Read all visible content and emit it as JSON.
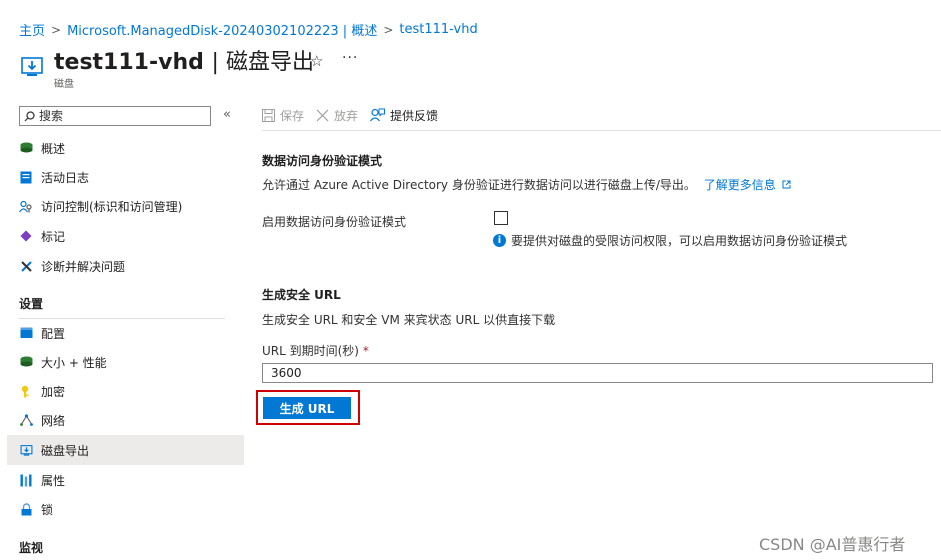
{
  "breadcrumb": {
    "home": "主页",
    "disk": "Microsoft.ManagedDisk-20240302102223 | 概述",
    "current": "test111-vhd"
  },
  "header": {
    "title": "test111-vhd",
    "section": "磁盘导出",
    "subtitle": "磁盘",
    "pin_icon": "☆",
    "more_icon": "···"
  },
  "sidebar": {
    "search_placeholder": "搜索",
    "collapse_icon": "«",
    "items": [
      {
        "label": "概述",
        "icon": "disk-icon"
      },
      {
        "label": "活动日志",
        "icon": "activity-log-icon"
      },
      {
        "label": "访问控制(标识和访问管理)",
        "icon": "iam-icon"
      },
      {
        "label": "标记",
        "icon": "tag-icon"
      },
      {
        "label": "诊断并解决问题",
        "icon": "wrench-icon"
      }
    ],
    "settings_header": "设置",
    "settings_items": [
      {
        "label": "配置",
        "icon": "configuration-icon"
      },
      {
        "label": "大小 + 性能",
        "icon": "disk-icon"
      },
      {
        "label": "加密",
        "icon": "key-icon"
      },
      {
        "label": "网络",
        "icon": "network-icon"
      },
      {
        "label": "磁盘导出",
        "icon": "disk-export-icon",
        "active": true
      },
      {
        "label": "属性",
        "icon": "properties-icon"
      },
      {
        "label": "锁",
        "icon": "lock-icon"
      }
    ],
    "monitoring_header": "监视"
  },
  "toolbar": {
    "save": "保存",
    "discard": "放弃",
    "feedback": "提供反馈"
  },
  "auth_mode": {
    "heading": "数据访问身份验证模式",
    "description": "允许通过 Azure Active Directory 身份验证进行数据访问以进行磁盘上传/导出。",
    "learn_more": "了解更多信息",
    "checkbox_label": "启用数据访问身份验证模式",
    "info_text": "要提供对磁盘的受限访问权限，可以启用数据访问身份验证模式"
  },
  "secure_url": {
    "heading": "生成安全 URL",
    "description": "生成安全 URL 和安全 VM 来宾状态 URL 以供直接下载",
    "expiry_label": "URL 到期时间(秒)",
    "required_mark": "*",
    "expiry_value": "3600",
    "generate_button": "生成 URL"
  },
  "watermark": "CSDN @AI普惠行者",
  "colors": {
    "accent": "#0078d4",
    "highlight_border": "#d00000"
  }
}
